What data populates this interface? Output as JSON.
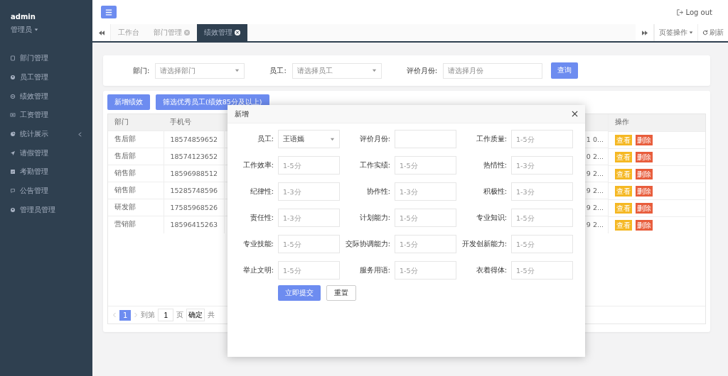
{
  "user": {
    "name": "admin",
    "role": "管理员"
  },
  "sidebar": {
    "items": [
      {
        "label": "部门管理",
        "expandable": false
      },
      {
        "label": "员工管理",
        "expandable": false
      },
      {
        "label": "绩效管理",
        "expandable": false
      },
      {
        "label": "工资管理",
        "expandable": false
      },
      {
        "label": "统计展示",
        "expandable": true
      },
      {
        "label": "请假管理",
        "expandable": false
      },
      {
        "label": "考勤管理",
        "expandable": false
      },
      {
        "label": "公告管理",
        "expandable": false
      },
      {
        "label": "管理员管理",
        "expandable": false
      }
    ]
  },
  "topbar": {
    "logout": "Log out"
  },
  "tabs": [
    {
      "label": "工作台",
      "selected": false,
      "closable": false
    },
    {
      "label": "部门管理",
      "selected": false,
      "closable": true
    },
    {
      "label": "绩效管理",
      "selected": true,
      "closable": true
    }
  ],
  "tab_tools": {
    "menu": "页签操作",
    "refresh": "刷新"
  },
  "filters": [
    {
      "label": "部门:",
      "placeholder": "请选择部门",
      "kind": "select"
    },
    {
      "label": "员工:",
      "placeholder": "请选择员工",
      "kind": "select"
    },
    {
      "label": "评价月份:",
      "placeholder": "请选择月份",
      "kind": "input"
    }
  ],
  "query_button": "查询",
  "toolbar": [
    "新增绩效",
    "筛选优秀员工(绩效85分及以上)"
  ],
  "table": {
    "columns": [
      "部门",
      "手机号",
      "操作"
    ],
    "rows": [
      {
        "dept": "售后部",
        "phone": "18574859652",
        "column_3": "1 0...",
        "actions": [
          "查看",
          "删除"
        ]
      },
      {
        "dept": "售后部",
        "phone": "18574123652",
        "column_3": "0 2...",
        "actions": [
          "查看",
          "删除"
        ]
      },
      {
        "dept": "销售部",
        "phone": "18596988512",
        "column_3": "9 2...",
        "actions": [
          "查看",
          "删除"
        ]
      },
      {
        "dept": "销售部",
        "phone": "15285748596",
        "column_3": "9 2...",
        "actions": [
          "查看",
          "删除"
        ]
      },
      {
        "dept": "研发部",
        "phone": "17585968526",
        "column_3": "9 2...",
        "actions": [
          "查看",
          "删除"
        ]
      },
      {
        "dept": "营销部",
        "phone": "18596415263",
        "column_3": "9 2...",
        "actions": [
          "查看",
          "删除"
        ]
      }
    ]
  },
  "pagination": {
    "pages": [
      {
        "label": "1",
        "selected": true
      }
    ],
    "goto": "到第",
    "page_value": "1",
    "page_unit": "页",
    "confirm": "确定",
    "total": "共"
  },
  "modal": {
    "title": "新增",
    "fields": [
      {
        "label": "员工:",
        "kind": "select",
        "value": "王语嫣"
      },
      {
        "label": "评价月份:",
        "kind": "input"
      },
      {
        "label": "工作质量:",
        "kind": "input",
        "placeholder": "1-5分"
      },
      {
        "label": "工作效率:",
        "kind": "input",
        "placeholder": "1-5分"
      },
      {
        "label": "工作实绩:",
        "kind": "input",
        "placeholder": "1-5分"
      },
      {
        "label": "热情性:",
        "kind": "input",
        "placeholder": "1-3分"
      },
      {
        "label": "纪律性:",
        "kind": "input",
        "placeholder": "1-3分"
      },
      {
        "label": "协作性:",
        "kind": "input",
        "placeholder": "1-3分"
      },
      {
        "label": "积极性:",
        "kind": "input",
        "placeholder": "1-3分"
      },
      {
        "label": "责任性:",
        "kind": "input",
        "placeholder": "1-3分"
      },
      {
        "label": "计划能力:",
        "kind": "input",
        "placeholder": "1-5分"
      },
      {
        "label": "专业知识:",
        "kind": "input",
        "placeholder": "1-5分"
      },
      {
        "label": "专业技能:",
        "kind": "input",
        "placeholder": "1-5分"
      },
      {
        "label": "交际协调能力:",
        "kind": "input",
        "placeholder": "1-5分"
      },
      {
        "label": "开发创新能力:",
        "kind": "input",
        "placeholder": "1-5分"
      },
      {
        "label": "举止文明:",
        "kind": "input",
        "placeholder": "1-5分"
      },
      {
        "label": "服务用语:",
        "kind": "input",
        "placeholder": "1-5分"
      },
      {
        "label": "衣着得体:",
        "kind": "input",
        "placeholder": "1-5分"
      }
    ],
    "submit": "立即提交",
    "reset": "重置"
  }
}
